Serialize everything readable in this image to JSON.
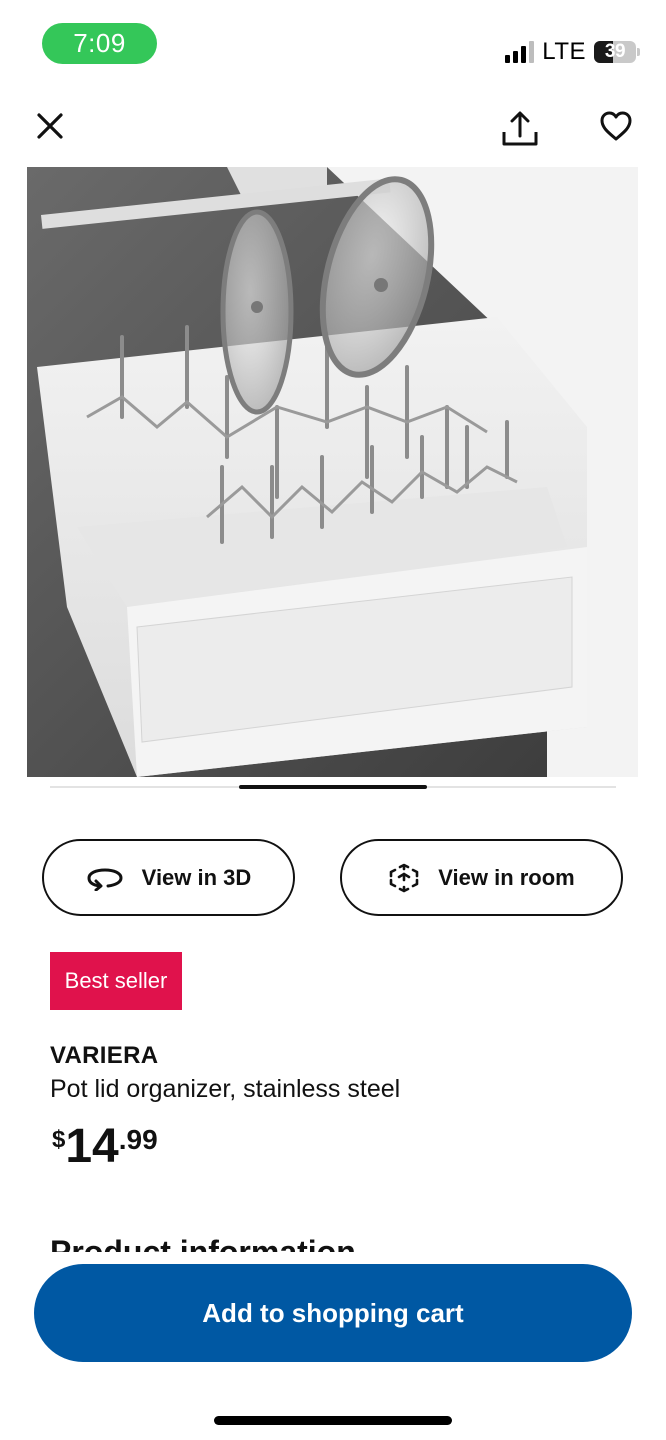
{
  "status_bar": {
    "time": "7:09",
    "network": "LTE",
    "battery": "39"
  },
  "nav": {
    "close_icon": "close-icon",
    "share_icon": "share-icon",
    "favorite_icon": "heart-icon"
  },
  "gallery": {
    "image_subject": "pot lid organizer in drawer",
    "position_fraction": 0.33
  },
  "actions": {
    "view_3d_label": "View in 3D",
    "view_room_label": "View in room"
  },
  "product": {
    "badge": "Best seller",
    "name": "VARIERA",
    "description": "Pot lid organizer, stainless steel",
    "price": {
      "currency": "$",
      "integer": "14",
      "decimal": ".99"
    }
  },
  "section_heading": "Product information",
  "cta": {
    "label": "Add to shopping cart"
  },
  "colors": {
    "badge": "#e0124c",
    "cta": "#0058a3",
    "time_pill": "#34c759"
  }
}
